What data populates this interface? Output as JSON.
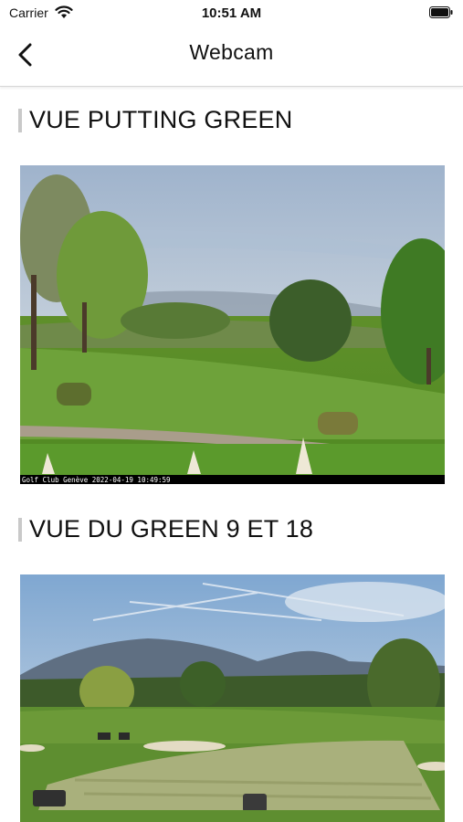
{
  "status_bar": {
    "carrier": "Carrier",
    "time": "10:51 AM"
  },
  "nav": {
    "title": "Webcam"
  },
  "sections": [
    {
      "title": "VUE PUTTING GREEN",
      "caption": "Golf Club Genève 2022-04-19 10:49:59"
    },
    {
      "title": "VUE DU GREEN 9 ET 18"
    }
  ],
  "icons": {
    "back": "chevron-left-icon",
    "wifi": "wifi-icon",
    "battery": "battery-icon"
  }
}
